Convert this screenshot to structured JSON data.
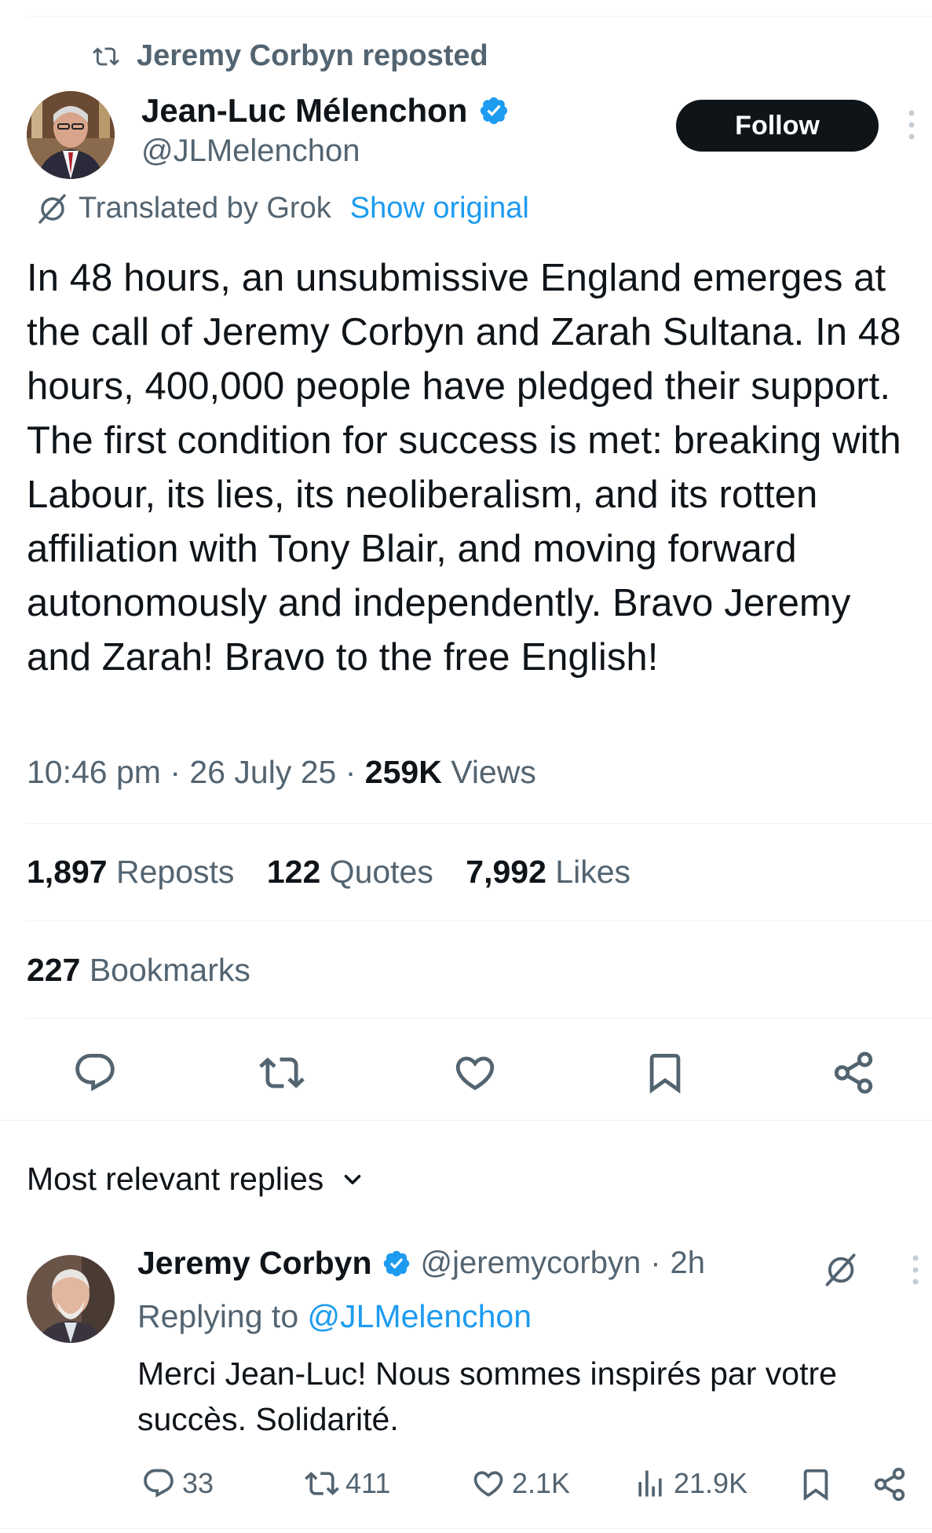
{
  "repost_header": {
    "text": "Jeremy Corbyn reposted"
  },
  "tweet": {
    "author_name": "Jean-Luc Mélenchon",
    "author_handle": "@JLMelenchon",
    "follow_label": "Follow",
    "translated_by": "Translated by Grok",
    "show_original": "Show original",
    "text": "In 48 hours, an unsubmissive England emerges at the call of Jeremy Corbyn and Zarah Sultana. In 48 hours, 400,000 people have pledged their support. The first condition for success is met: breaking with Labour, its lies, its neoliberalism, and its rotten affiliation with Tony Blair, and moving forward autonomously and independently. Bravo Jeremy and Zarah! Bravo to the free English!",
    "time": "10:46 pm",
    "date": "26 July 25",
    "separator": "·",
    "views_count": "259K",
    "views_label": "Views"
  },
  "stats": {
    "reposts_count": "1,897",
    "reposts_label": "Reposts",
    "quotes_count": "122",
    "quotes_label": "Quotes",
    "likes_count": "7,992",
    "likes_label": "Likes",
    "bookmarks_count": "227",
    "bookmarks_label": "Bookmarks"
  },
  "replies_header": {
    "label": "Most relevant replies"
  },
  "reply": {
    "author_name": "Jeremy Corbyn",
    "author_handle": "@jeremycorbyn",
    "age": "2h",
    "replying_prefix": "Replying to",
    "replying_to": "@JLMelenchon",
    "text": "Merci Jean-Luc! Nous sommes inspirés par votre succès. Solidarité.",
    "reply_count": "33",
    "repost_count": "411",
    "like_count": "2.1K",
    "view_count": "21.9K"
  },
  "colors": {
    "accent": "#1d9bf0",
    "text": "#0f1419",
    "secondary": "#536471",
    "divider": "#eff3f4"
  },
  "icons": [
    "repost-icon",
    "verified-badge-icon",
    "more-icon",
    "grok-icon",
    "reply-icon",
    "like-icon",
    "bookmark-icon",
    "share-icon",
    "chevron-down-icon",
    "views-icon"
  ]
}
